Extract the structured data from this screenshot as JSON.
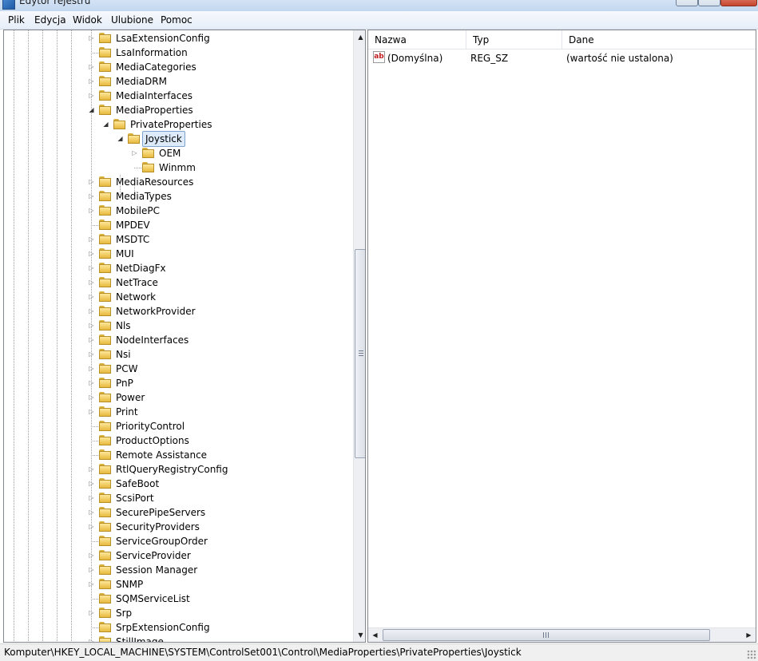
{
  "window": {
    "title": "Edytor rejestru"
  },
  "menu": [
    "Plik",
    "Edycja",
    "Widok",
    "Ulubione",
    "Pomoc"
  ],
  "tree": {
    "nodes": [
      {
        "label": "LsaExtensionConfig",
        "level": 0,
        "expander": "collapsed"
      },
      {
        "label": "LsaInformation",
        "level": 0,
        "expander": "none"
      },
      {
        "label": "MediaCategories",
        "level": 0,
        "expander": "collapsed"
      },
      {
        "label": "MediaDRM",
        "level": 0,
        "expander": "collapsed"
      },
      {
        "label": "MediaInterfaces",
        "level": 0,
        "expander": "collapsed"
      },
      {
        "label": "MediaProperties",
        "level": 0,
        "expander": "expanded"
      },
      {
        "label": "PrivateProperties",
        "level": 1,
        "expander": "expanded"
      },
      {
        "label": "Joystick",
        "level": 2,
        "expander": "expanded",
        "selected": true
      },
      {
        "label": "OEM",
        "level": 3,
        "expander": "collapsed"
      },
      {
        "label": "Winmm",
        "level": 3,
        "expander": "none"
      },
      {
        "label": "MediaResources",
        "level": 0,
        "expander": "collapsed"
      },
      {
        "label": "MediaTypes",
        "level": 0,
        "expander": "collapsed"
      },
      {
        "label": "MobilePC",
        "level": 0,
        "expander": "collapsed"
      },
      {
        "label": "MPDEV",
        "level": 0,
        "expander": "none"
      },
      {
        "label": "MSDTC",
        "level": 0,
        "expander": "collapsed"
      },
      {
        "label": "MUI",
        "level": 0,
        "expander": "collapsed"
      },
      {
        "label": "NetDiagFx",
        "level": 0,
        "expander": "collapsed"
      },
      {
        "label": "NetTrace",
        "level": 0,
        "expander": "collapsed"
      },
      {
        "label": "Network",
        "level": 0,
        "expander": "collapsed"
      },
      {
        "label": "NetworkProvider",
        "level": 0,
        "expander": "collapsed"
      },
      {
        "label": "Nls",
        "level": 0,
        "expander": "collapsed"
      },
      {
        "label": "NodeInterfaces",
        "level": 0,
        "expander": "collapsed"
      },
      {
        "label": "Nsi",
        "level": 0,
        "expander": "collapsed"
      },
      {
        "label": "PCW",
        "level": 0,
        "expander": "collapsed"
      },
      {
        "label": "PnP",
        "level": 0,
        "expander": "collapsed"
      },
      {
        "label": "Power",
        "level": 0,
        "expander": "collapsed"
      },
      {
        "label": "Print",
        "level": 0,
        "expander": "collapsed"
      },
      {
        "label": "PriorityControl",
        "level": 0,
        "expander": "none"
      },
      {
        "label": "ProductOptions",
        "level": 0,
        "expander": "none"
      },
      {
        "label": "Remote Assistance",
        "level": 0,
        "expander": "none"
      },
      {
        "label": "RtlQueryRegistryConfig",
        "level": 0,
        "expander": "collapsed"
      },
      {
        "label": "SafeBoot",
        "level": 0,
        "expander": "collapsed"
      },
      {
        "label": "ScsiPort",
        "level": 0,
        "expander": "collapsed"
      },
      {
        "label": "SecurePipeServers",
        "level": 0,
        "expander": "collapsed"
      },
      {
        "label": "SecurityProviders",
        "level": 0,
        "expander": "collapsed"
      },
      {
        "label": "ServiceGroupOrder",
        "level": 0,
        "expander": "none"
      },
      {
        "label": "ServiceProvider",
        "level": 0,
        "expander": "collapsed"
      },
      {
        "label": "Session Manager",
        "level": 0,
        "expander": "collapsed"
      },
      {
        "label": "SNMP",
        "level": 0,
        "expander": "collapsed"
      },
      {
        "label": "SQMServiceList",
        "level": 0,
        "expander": "none"
      },
      {
        "label": "Srp",
        "level": 0,
        "expander": "collapsed"
      },
      {
        "label": "SrpExtensionConfig",
        "level": 0,
        "expander": "none"
      },
      {
        "label": "StillImage",
        "level": 0,
        "expander": "collapsed"
      }
    ],
    "scroll": {
      "up_glyph": "▲",
      "down_glyph": "▼",
      "grip": "≡"
    }
  },
  "list": {
    "columns": [
      "Nazwa",
      "Typ",
      "Dane"
    ],
    "rows": [
      {
        "icon": "ab",
        "name": "(Domyślna)",
        "type": "REG_SZ",
        "data": "(wartość nie ustalona)"
      }
    ],
    "hscroll": {
      "left_glyph": "◀",
      "right_glyph": "▶",
      "grip": "Ⅲ"
    }
  },
  "status": {
    "path": "Komputer\\HKEY_LOCAL_MACHINE\\SYSTEM\\ControlSet001\\Control\\MediaProperties\\PrivateProperties\\Joystick"
  },
  "colors": {
    "selection": "#dceaf9",
    "folder": "#e7b93e",
    "pane_border": "#828790"
  }
}
